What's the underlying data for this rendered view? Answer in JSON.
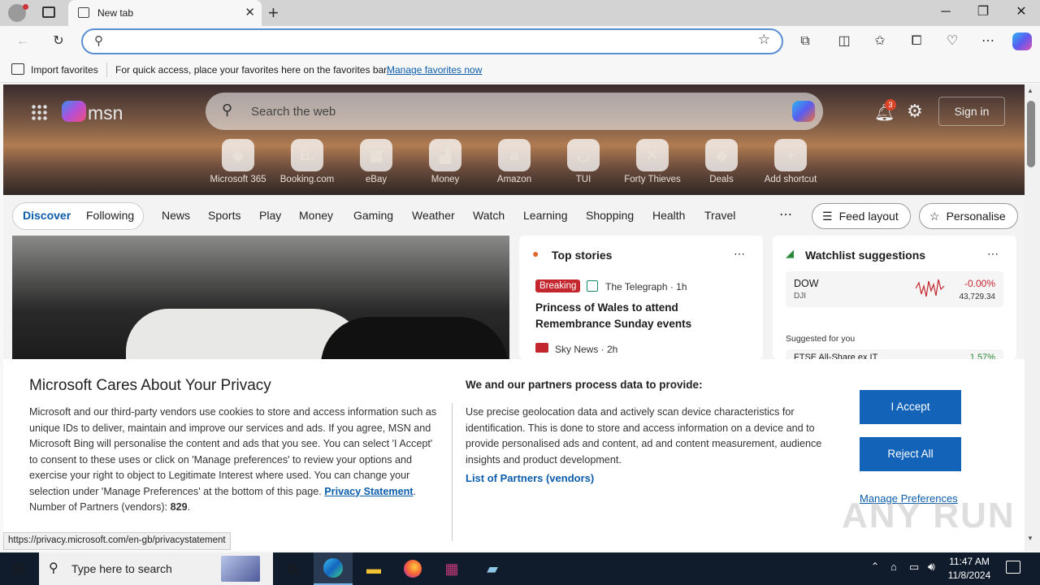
{
  "browser": {
    "tab_title": "New tab",
    "address_value": "",
    "favorites_bar": {
      "import_label": "Import favorites",
      "message": "For quick access, place your favorites here on the favorites bar.",
      "manage_link": "Manage favorites now"
    }
  },
  "msn": {
    "logo": "msn",
    "search_placeholder": "Search the web",
    "notification_count": "3",
    "signin_label": "Sign in",
    "shortcuts": [
      {
        "label": "Microsoft 365",
        "icon": "microsoft365-icon",
        "glyph": "◆"
      },
      {
        "label": "Booking.com",
        "icon": "booking-icon",
        "glyph": "B."
      },
      {
        "label": "eBay",
        "icon": "ebay-icon",
        "glyph": "▦"
      },
      {
        "label": "Money",
        "icon": "money-chart-icon",
        "glyph": "▟"
      },
      {
        "label": "Amazon",
        "icon": "amazon-icon",
        "glyph": "a"
      },
      {
        "label": "TUI",
        "icon": "tui-icon",
        "glyph": "◡"
      },
      {
        "label": "Forty Thieves",
        "icon": "crossed-swords-icon",
        "glyph": "✕"
      },
      {
        "label": "Deals",
        "icon": "deals-tag-icon",
        "glyph": "◆"
      },
      {
        "label": "Add shortcut",
        "icon": "plus-icon",
        "glyph": "+"
      }
    ],
    "tabs": {
      "discover": "Discover",
      "following": "Following"
    },
    "nav_items": [
      "News",
      "Sports",
      "Play",
      "Money",
      "Gaming",
      "Weather",
      "Watch",
      "Learning",
      "Shopping",
      "Health",
      "Travel"
    ],
    "feed_layout_label": "Feed layout",
    "personalise_label": "Personalise",
    "top_stories": {
      "title": "Top stories",
      "badge": "Breaking",
      "source1": "The Telegraph · 1h",
      "headline1": "Princess of Wales to attend Remembrance Sunday events",
      "source2": "Sky News · 2h"
    },
    "watchlist": {
      "title": "Watchlist suggestions",
      "symbol": "DOW",
      "symbol_sub": "DJI",
      "change": "-0.00%",
      "price": "43,729.34",
      "suggested_label": "Suggested for you",
      "partial_row": "FTSE All-Share ex IT",
      "partial_change": "1.57%"
    }
  },
  "privacy": {
    "title": "Microsoft Cares About Your Privacy",
    "body_pre": "Microsoft and our third-party vendors use cookies to store and access information such as unique IDs to deliver, maintain and improve our services and ads. If you agree, MSN and Microsoft Bing will personalise the content and ads that you see. You can select 'I Accept' to consent to these uses or click on 'Manage preferences' to review your options and exercise your right to object to Legitimate Interest where used.  You can change your selection under 'Manage Preferences' at the bottom of this page.",
    "privacy_link": "Privacy Statement",
    "partners_label": "Number of Partners (vendors):",
    "partners_count": "829",
    "right_title": "We and our partners process data to provide:",
    "right_body": "Use precise geolocation data and actively scan device characteristics for identification. This is done to store and access information on a device and to provide personalised ads and content, ad and content measurement, audience insights and product development.",
    "list_link": "List of Partners (vendors)",
    "accept": "I Accept",
    "reject": "Reject All",
    "manage": "Manage Preferences"
  },
  "status_url": "https://privacy.microsoft.com/en-gb/privacystatement",
  "taskbar": {
    "search_placeholder": "Type here to search",
    "time": "11:47 AM",
    "date": "11/8/2024"
  },
  "watermark": "ANY RUN",
  "colors": {
    "accent": "#1363b8",
    "link": "#0b5cab",
    "breaking": "#c4262e",
    "negative": "#c4262e"
  }
}
